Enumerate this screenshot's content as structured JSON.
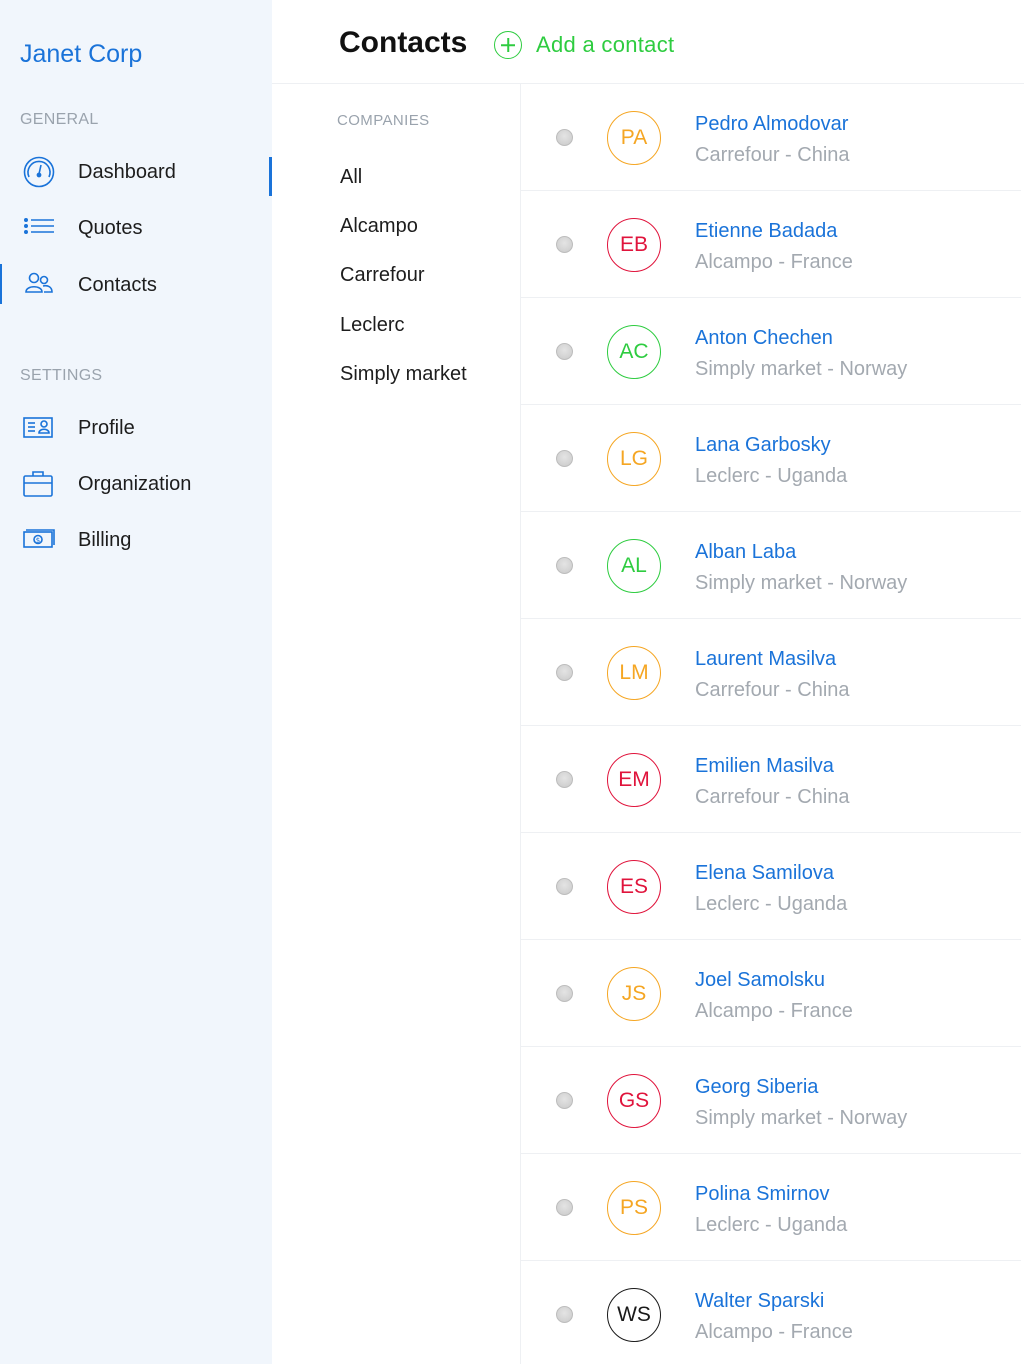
{
  "sidebar": {
    "brand": "Janet Corp",
    "general_label": "GENERAL",
    "settings_label": "SETTINGS",
    "general_items": [
      {
        "label": "Dashboard",
        "icon": "dashboard-gauge-icon"
      },
      {
        "label": "Quotes",
        "icon": "list-icon"
      },
      {
        "label": "Contacts",
        "icon": "users-icon"
      }
    ],
    "settings_items": [
      {
        "label": "Profile",
        "icon": "id-card-icon"
      },
      {
        "label": "Organization",
        "icon": "briefcase-icon"
      },
      {
        "label": "Billing",
        "icon": "banknote-icon"
      }
    ],
    "accent_color": "#1a73d9"
  },
  "header": {
    "title": "Contacts",
    "add_label": "Add a contact",
    "add_color": "#2ecc40"
  },
  "companies": {
    "label": "COMPANIES",
    "items": [
      "All",
      "Alcampo",
      "Carrefour",
      "Leclerc",
      "Simply market"
    ]
  },
  "contacts": [
    {
      "initials": "PA",
      "name": "Pedro Almodovar",
      "sub": "Carrefour - China",
      "color": "#f5a623"
    },
    {
      "initials": "EB",
      "name": "Etienne Badada",
      "sub": "Alcampo - France",
      "color": "#e0143c"
    },
    {
      "initials": "AC",
      "name": "Anton Chechen",
      "sub": "Simply market - Norway",
      "color": "#2ecc40"
    },
    {
      "initials": "LG",
      "name": "Lana Garbosky",
      "sub": "Leclerc - Uganda",
      "color": "#f5a623"
    },
    {
      "initials": "AL",
      "name": "Alban Laba",
      "sub": "Simply market - Norway",
      "color": "#2ecc40"
    },
    {
      "initials": "LM",
      "name": "Laurent Masilva",
      "sub": "Carrefour - China",
      "color": "#f5a623"
    },
    {
      "initials": "EM",
      "name": "Emilien Masilva",
      "sub": "Carrefour - China",
      "color": "#e0143c"
    },
    {
      "initials": "ES",
      "name": "Elena Samilova",
      "sub": "Leclerc - Uganda",
      "color": "#e0143c"
    },
    {
      "initials": "JS",
      "name": "Joel Samolsku",
      "sub": "Alcampo - France",
      "color": "#f5a623"
    },
    {
      "initials": "GS",
      "name": "Georg Siberia",
      "sub": "Simply market - Norway",
      "color": "#e0143c"
    },
    {
      "initials": "PS",
      "name": "Polina Smirnov",
      "sub": "Leclerc - Uganda",
      "color": "#f5a623"
    },
    {
      "initials": "WS",
      "name": "Walter Sparski",
      "sub": "Alcampo - France",
      "color": "#1a1a1a"
    }
  ]
}
